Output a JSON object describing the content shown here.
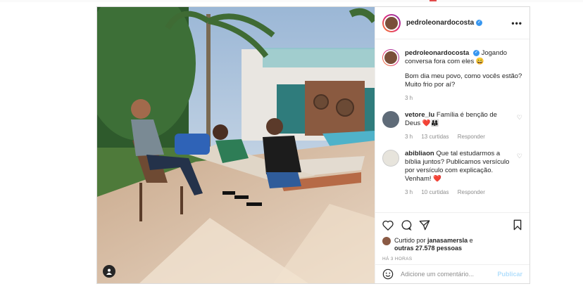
{
  "post": {
    "username": "pedroleonardocosta",
    "caption_text": "Jogando conversa fora com eles 😄",
    "caption_body": "Bom dia meu povo, como vocês estão? Muito frio por aí?",
    "caption_time": "3 h",
    "comments": [
      {
        "user": "vetore_lu",
        "text": "Família é benção de Deus ❤️👨‍👩‍👧",
        "time": "3 h",
        "likes": "13 curtidas",
        "reply": "Responder"
      },
      {
        "user": "abibliaon",
        "text": "Que tal estudarmos a bíblia juntos? Publicamos versículo por versículo com explicação. Venham! ❤️",
        "time": "3 h",
        "likes": "10 curtidas",
        "reply": "Responder"
      }
    ],
    "liked_by_prefix": "Curtido por",
    "liked_by_user": "janasamersla",
    "liked_by_mid": " e",
    "liked_by_count": "outras 27.578 pessoas",
    "posted_ago": "HÁ 3 HORAS",
    "add_comment_placeholder": "Adicione um comentário...",
    "publish_label": "Publicar",
    "more_label": "•••"
  },
  "colors": {
    "verified": "#3897f0",
    "link_disabled": "#b2dffc",
    "muted": "#8e8e8e"
  }
}
